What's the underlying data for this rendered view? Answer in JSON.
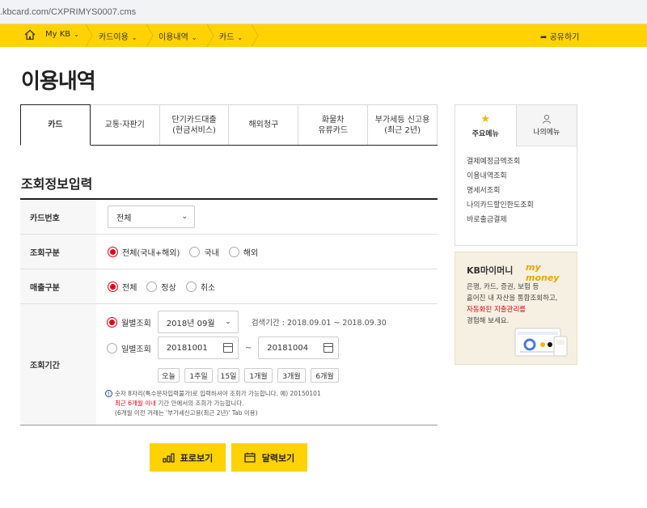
{
  "browser": {
    "url": ".kbcard.com/CXPRIMYS0007.cms"
  },
  "nav": {
    "items": [
      {
        "label": "My KB"
      },
      {
        "label": "카드이용"
      },
      {
        "label": "이용내역"
      },
      {
        "label": "카드"
      }
    ],
    "share_label": "공유하기"
  },
  "page": {
    "title": "이용내역"
  },
  "tabs": [
    {
      "line1": "카드",
      "line2": ""
    },
    {
      "line1": "교통·자판기",
      "line2": ""
    },
    {
      "line1": "단기카드대출",
      "line2": "(현금서비스)"
    },
    {
      "line1": "해외청구",
      "line2": ""
    },
    {
      "line1": "화물차",
      "line2": "유류카드"
    },
    {
      "line1": "부가세등 신고용",
      "line2": "(최근 2년)"
    }
  ],
  "form": {
    "section_title": "조회정보입력",
    "card_number": {
      "label": "카드번호",
      "value": "전체"
    },
    "inquiry_type": {
      "label": "조회구분",
      "options": [
        "전체(국내+해외)",
        "국내",
        "해외"
      ],
      "selected_index": 0
    },
    "sales_type": {
      "label": "매출구분",
      "options": [
        "전체",
        "정상",
        "취소"
      ],
      "selected_index": 0
    },
    "period": {
      "label": "조회기간",
      "monthly_label": "월별조회",
      "monthly_value": "2018년 09월",
      "search_range": "검색기간 : 2018.09.01 ~ 2018.09.30",
      "daily_label": "일별조회",
      "start_date": "20181001",
      "range_sep": "~",
      "end_date": "20181004",
      "quick_buttons": [
        "오늘",
        "1주일",
        "15일",
        "1개월",
        "3개월",
        "6개월"
      ],
      "note_line1": "숫자 8자리(특수문자입력불가)로 입력하셔야 조회가 가능합니다. 예) 20150101",
      "note_line2_red": "최근 6개월 이내",
      "note_line2_rest": " 기간 안에서의 조회가 가능합니다.",
      "note_line3": "(6개월 이전 거래는 '부가세신고용(최근 2년)' Tab 이용)"
    }
  },
  "buttons": {
    "table_view": "표로보기",
    "calendar_view": "달력보기"
  },
  "side": {
    "tab_main": "주요메뉴",
    "tab_my": "나의메뉴",
    "links": [
      "결제예정금액조회",
      "이용내역조회",
      "명세서조회",
      "나의카드할인한도조회",
      "바로출금결제"
    ]
  },
  "banner": {
    "title": "KB마이머니",
    "logo": "my money",
    "line1": "은행, 카드, 증권, 보험 등",
    "line2": "흩어진 내 자산을 통합조회하고,",
    "line3": "자동화된 지출관리를",
    "line4": "경험해 보세요."
  },
  "colors": {
    "brand_yellow": "#ffd200",
    "accent_red": "#e60012"
  }
}
